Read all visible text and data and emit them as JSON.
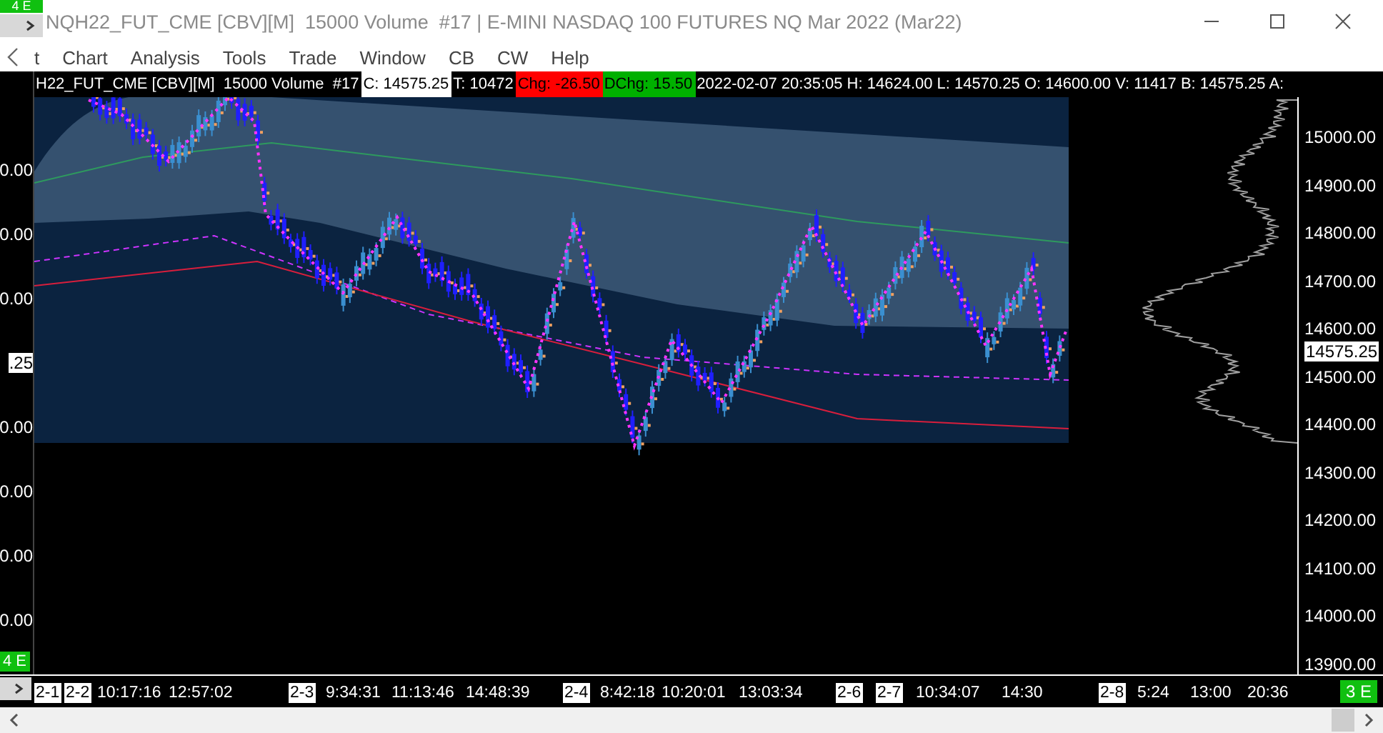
{
  "background_window": {
    "badge_top": "4 E",
    "badge_bottom": "4 E",
    "axis_labels": [
      {
        "kind": "tick",
        "text": "0.00"
      },
      {
        "kind": "tick",
        "text": "0.00"
      },
      {
        "kind": "tick",
        "text": "0.00"
      },
      {
        "kind": "marker",
        "text": ".25"
      },
      {
        "kind": "tick",
        "text": "0.00"
      },
      {
        "kind": "tick",
        "text": "0.00"
      },
      {
        "kind": "tick",
        "text": "0.00"
      },
      {
        "kind": "tick",
        "text": "0.00"
      }
    ]
  },
  "window": {
    "title": "NQH22_FUT_CME [CBV][M]  15000 Volume  #17 | E-MINI NASDAQ 100 FUTURES NQ Mar 2022 (Mar22)",
    "menu": [
      "t",
      "Chart",
      "Analysis",
      "Tools",
      "Trade",
      "Window",
      "CB",
      "CW",
      "Help"
    ],
    "info_bar": [
      {
        "kind": "plain",
        "text": "H22_FUT_CME [CBV][M]  15000 Volume  #17"
      },
      {
        "kind": "light",
        "text": "C: 14575.25"
      },
      {
        "kind": "plain",
        "text": "T: 10472"
      },
      {
        "kind": "down",
        "text": "Chg: -26.50"
      },
      {
        "kind": "up",
        "text": "DChg: 15.50"
      },
      {
        "kind": "plain",
        "text": "2022-02-07 20:35:05 H: 14624.00 L: 14570.25 O: 14600.00 V: 11417 B: 14575.25 A:"
      }
    ],
    "price_axis": {
      "ticks": [
        "15000.00",
        "14900.00",
        "14800.00",
        "14700.00",
        "14600.00",
        "14500.00",
        "14400.00",
        "14300.00",
        "14200.00",
        "14100.00",
        "14000.00",
        "13900.00"
      ],
      "last_price": "14575.25"
    },
    "time_axis": [
      {
        "kind": "date",
        "text": "2-1"
      },
      {
        "kind": "date",
        "text": "2-2"
      },
      {
        "kind": "time",
        "text": "10:17:16"
      },
      {
        "kind": "time",
        "text": "12:57:02"
      },
      {
        "kind": "date",
        "text": "2-3"
      },
      {
        "kind": "time",
        "text": "9:34:31"
      },
      {
        "kind": "time",
        "text": "11:13:46"
      },
      {
        "kind": "time",
        "text": "14:48:39"
      },
      {
        "kind": "date",
        "text": "2-4"
      },
      {
        "kind": "time",
        "text": "8:42:18"
      },
      {
        "kind": "time",
        "text": "10:20:01"
      },
      {
        "kind": "time",
        "text": "13:03:34"
      },
      {
        "kind": "date",
        "text": "2-6"
      },
      {
        "kind": "date",
        "text": "2-7"
      },
      {
        "kind": "time",
        "text": "10:34:07"
      },
      {
        "kind": "time",
        "text": "14:30"
      },
      {
        "kind": "date",
        "text": "2-8"
      },
      {
        "kind": "time",
        "text": "5:24"
      },
      {
        "kind": "time",
        "text": "13:00"
      },
      {
        "kind": "time",
        "text": "20:36"
      }
    ],
    "corner_badge": "3 E"
  }
}
